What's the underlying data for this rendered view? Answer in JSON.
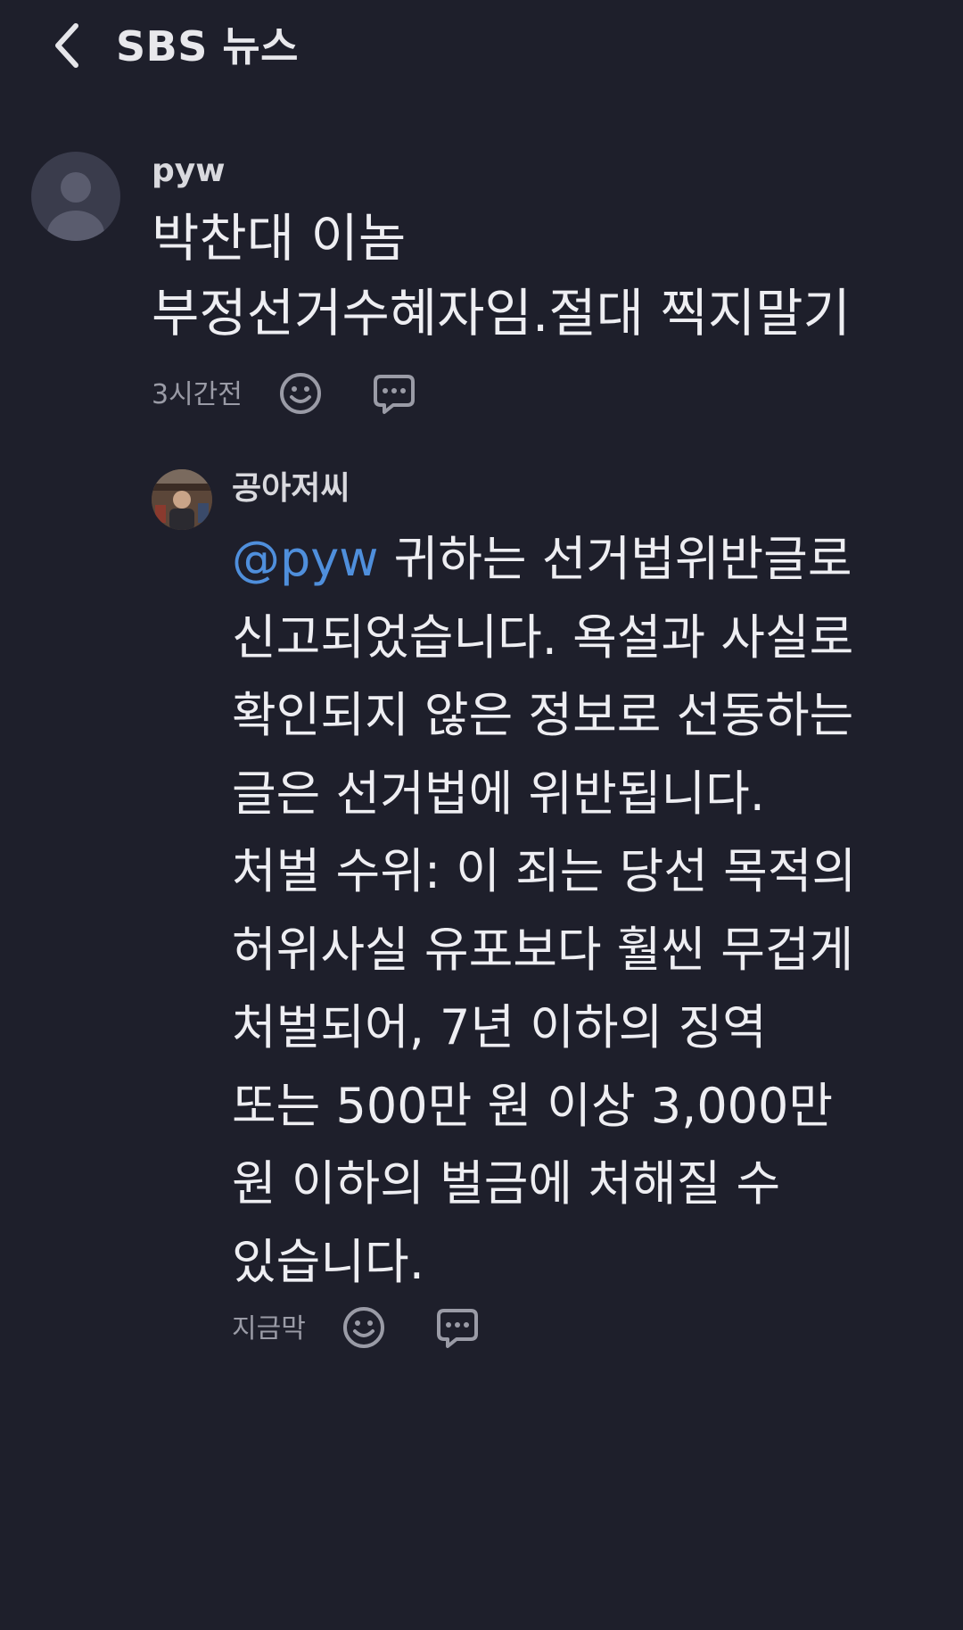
{
  "header": {
    "title": "SBS 뉴스"
  },
  "comments": [
    {
      "author": "pyw",
      "lines": [
        "박찬대 이놈",
        "부정선거수혜자임.절대 찍지말기"
      ],
      "time": "3시간전"
    }
  ],
  "reply": {
    "author": "공아저씨",
    "mention": "@pyw",
    "first_line_rest": " 귀하는 선거법위반글로",
    "lines": [
      "신고되었습니다. 욕설과 사실로",
      "확인되지 않은 정보로 선동하는",
      "글은 선거법에 위반됩니다.",
      "처벌 수위: 이 죄는 당선 목적의",
      "허위사실 유포보다 훨씬 무겁게",
      "처벌되어, 7년 이하의 징역",
      "또는 500만 원 이상 3,000만",
      "원 이하의 벌금에 처해질 수",
      "있습니다."
    ],
    "time": "지금막"
  },
  "icons": {
    "back": "chevron-left-icon",
    "emoji": "smiley-icon",
    "reply": "speech-bubble-icon"
  },
  "colors": {
    "background": "#1e1f2b",
    "mention": "#4f8fdc",
    "muted": "#9a9ba6"
  }
}
